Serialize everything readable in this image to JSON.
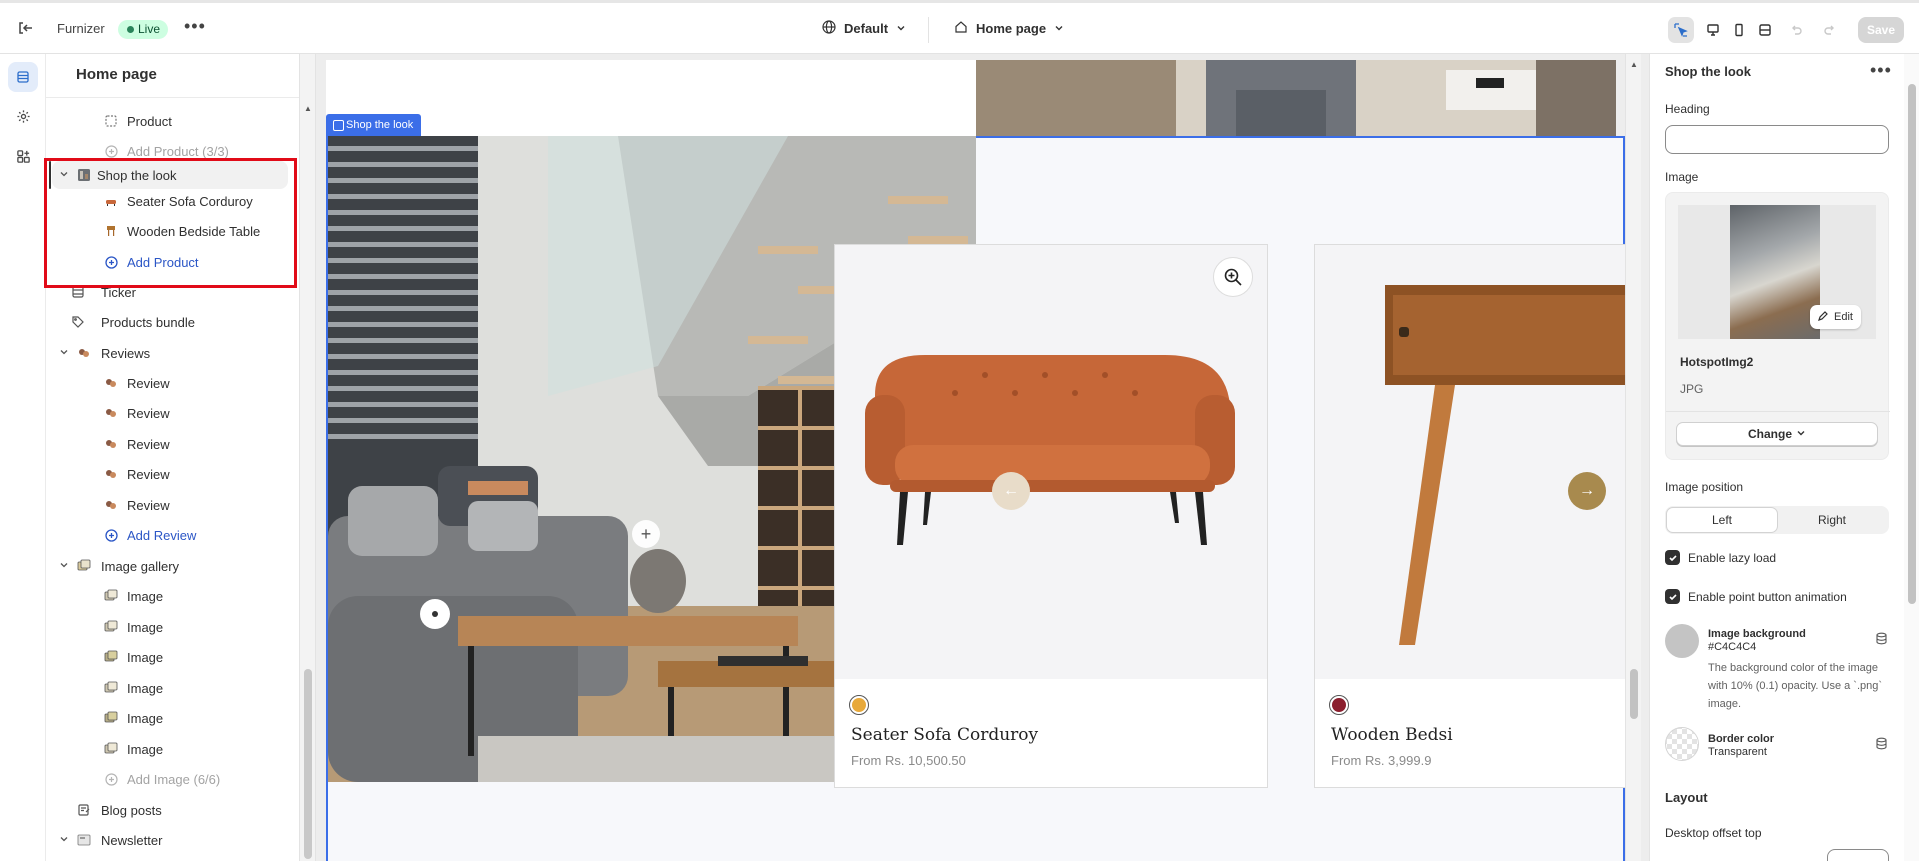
{
  "topbar": {
    "store_name": "Furnizer",
    "live_badge": "Live",
    "theme_label": "Default",
    "page_label": "Home page",
    "save_label": "Save"
  },
  "left_panel": {
    "title": "Home page",
    "items": [
      {
        "label": "Product",
        "icon": "dashed-square-icon",
        "depth": 2,
        "style": "normal"
      },
      {
        "label": "Add Product (3/3)",
        "icon": "plus-circle-icon",
        "depth": 2,
        "style": "muted"
      },
      {
        "label": "Shop the look",
        "icon": "image-section-icon",
        "depth": 1,
        "style": "selected",
        "chevron": "down"
      },
      {
        "label": "Seater Sofa Corduroy",
        "icon": "sofa-thumb-icon",
        "depth": 2,
        "style": "normal"
      },
      {
        "label": "Wooden Bedside Table",
        "icon": "table-thumb-icon",
        "depth": 2,
        "style": "normal"
      },
      {
        "label": "Add Product",
        "icon": "plus-circle-icon",
        "depth": 2,
        "style": "blue"
      },
      {
        "label": "Ticker",
        "icon": "ticker-icon",
        "depth": 1,
        "style": "normal"
      },
      {
        "label": "Products bundle",
        "icon": "tag-icon",
        "depth": 1,
        "style": "normal"
      },
      {
        "label": "Reviews",
        "icon": "reviews-icon",
        "depth": 1,
        "style": "normal",
        "chevron": "down"
      },
      {
        "label": "Review",
        "icon": "review-thumb-icon",
        "depth": 2,
        "style": "normal"
      },
      {
        "label": "Review",
        "icon": "review-thumb-icon",
        "depth": 2,
        "style": "normal"
      },
      {
        "label": "Review",
        "icon": "review-thumb-icon",
        "depth": 2,
        "style": "normal"
      },
      {
        "label": "Review",
        "icon": "review-thumb-icon",
        "depth": 2,
        "style": "normal"
      },
      {
        "label": "Review",
        "icon": "review-thumb-icon",
        "depth": 2,
        "style": "normal"
      },
      {
        "label": "Add Review",
        "icon": "plus-circle-icon",
        "depth": 2,
        "style": "blue"
      },
      {
        "label": "Image gallery",
        "icon": "gallery-icon",
        "depth": 1,
        "style": "normal",
        "chevron": "down"
      },
      {
        "label": "Image",
        "icon": "gallery-thumb-icon",
        "depth": 2,
        "style": "normal"
      },
      {
        "label": "Image",
        "icon": "gallery-thumb-icon",
        "depth": 2,
        "style": "normal"
      },
      {
        "label": "Image",
        "icon": "gallery-thumb-icon",
        "depth": 2,
        "style": "normal"
      },
      {
        "label": "Image",
        "icon": "gallery-thumb-icon",
        "depth": 2,
        "style": "normal"
      },
      {
        "label": "Image",
        "icon": "gallery-thumb-icon",
        "depth": 2,
        "style": "normal"
      },
      {
        "label": "Image",
        "icon": "gallery-thumb-icon",
        "depth": 2,
        "style": "normal"
      },
      {
        "label": "Add Image (6/6)",
        "icon": "plus-circle-icon",
        "depth": 2,
        "style": "muted"
      },
      {
        "label": "Blog posts",
        "icon": "blog-icon",
        "depth": 1,
        "style": "normal"
      },
      {
        "label": "Newsletter",
        "icon": "newsletter-icon",
        "depth": 1,
        "style": "normal",
        "chevron": "down"
      }
    ]
  },
  "preview": {
    "section_tag": "Shop the look",
    "cards": [
      {
        "title": "Seater Sofa Corduroy",
        "price": "From Rs. 10,500.50",
        "swatch_color": "#e8a93a"
      },
      {
        "title": "Wooden Bedsi",
        "price": "From Rs. 3,999.9",
        "swatch_color": "#8b1e2d"
      }
    ]
  },
  "right_panel": {
    "title": "Shop the look",
    "heading_label": "Heading",
    "heading_value": "",
    "image_label": "Image",
    "image_name": "HotspotImg2",
    "image_type": "JPG",
    "edit_label": "Edit",
    "change_label": "Change",
    "image_position_label": "Image position",
    "position_options": [
      "Left",
      "Right"
    ],
    "position_selected": "Left",
    "lazy_load_label": "Enable lazy load",
    "lazy_load_checked": true,
    "point_anim_label": "Enable point button animation",
    "point_anim_checked": true,
    "image_bg": {
      "title": "Image background",
      "value": "#C4C4C4",
      "description": "The background color of the image with 10% (0.1) opacity. Use a `.png` image."
    },
    "border_color": {
      "title": "Border color",
      "value": "Transparent"
    },
    "layout_label": "Layout",
    "desktop_offset_label": "Desktop offset top"
  },
  "colors": {
    "accent_blue": "#3b6ee8",
    "highlight_red": "#e10b18",
    "live_green": "#cdfee1"
  }
}
